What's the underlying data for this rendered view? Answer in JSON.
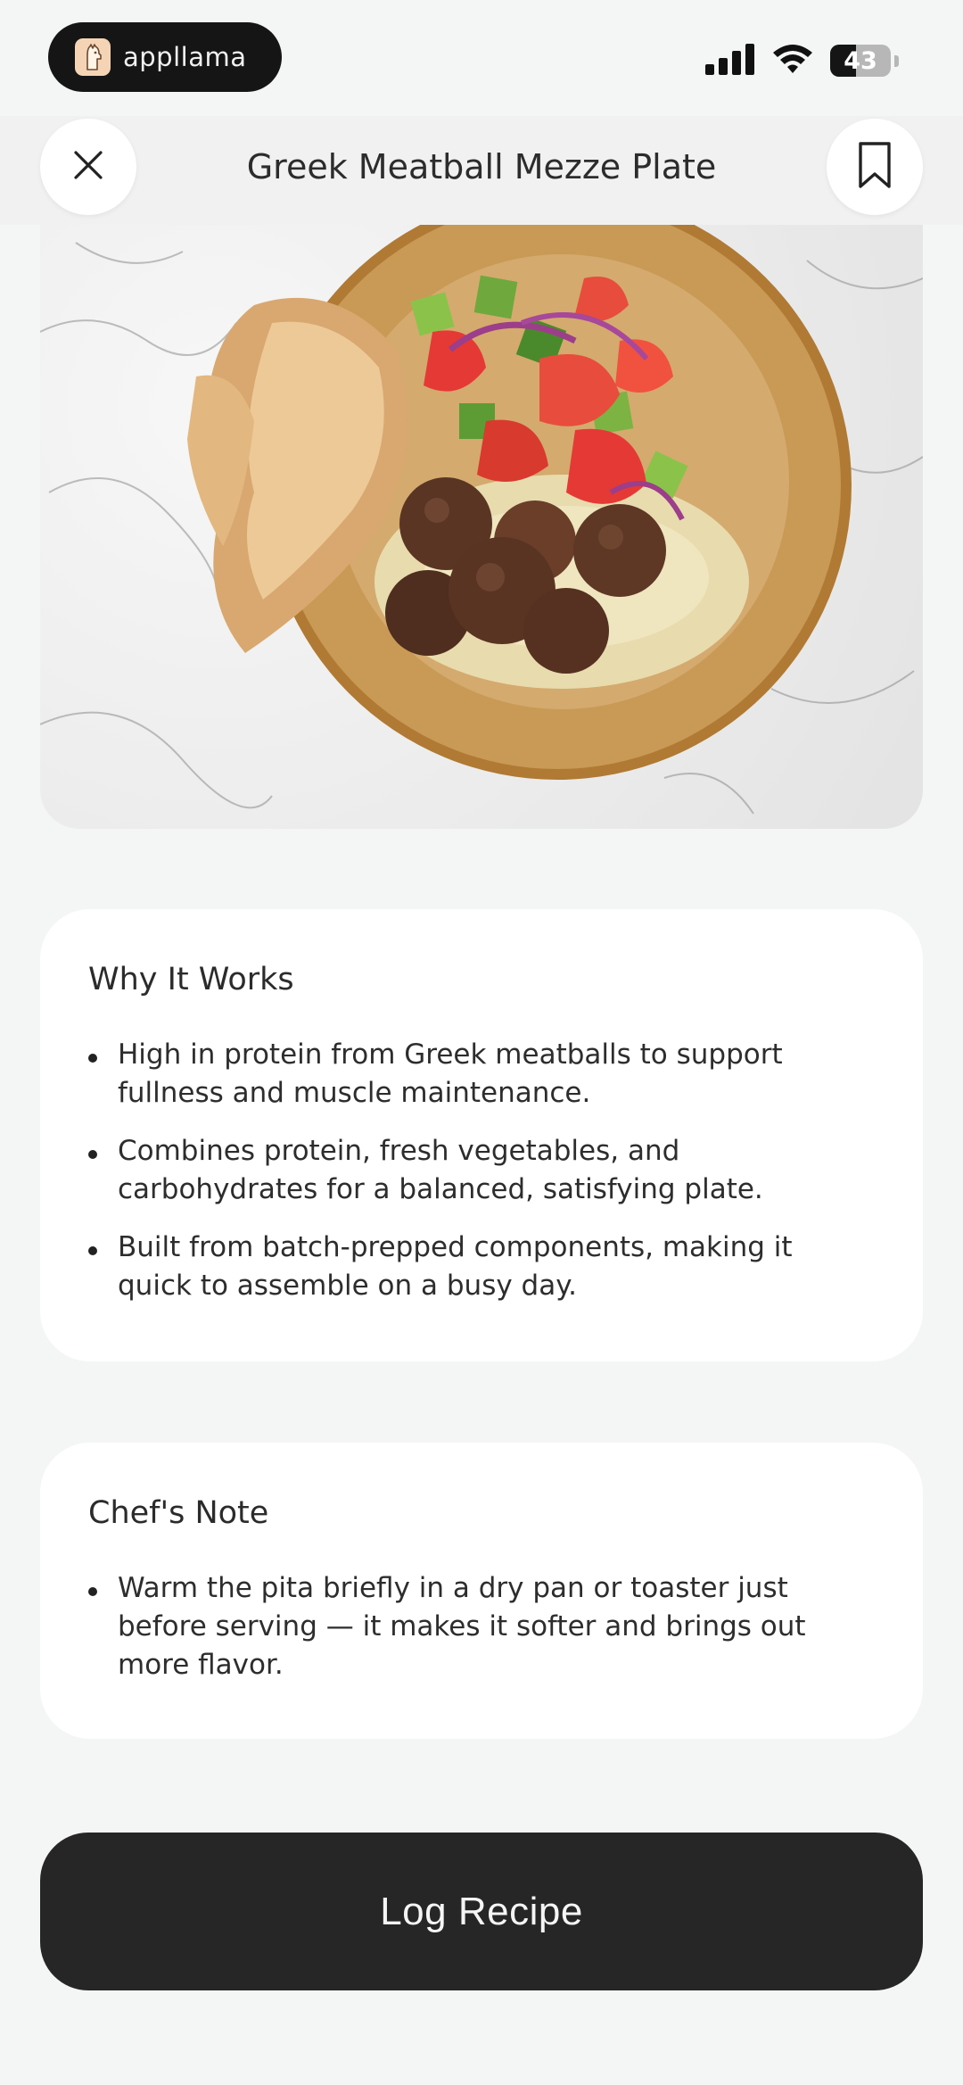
{
  "status_bar": {
    "app_name": "appllama",
    "battery_level": "43",
    "battery_fraction": 0.43
  },
  "header": {
    "title": "Greek Meatball Mezze Plate",
    "close_icon": "close-icon",
    "bookmark_icon": "bookmark-icon"
  },
  "hero": {
    "image_subject": "meal photo"
  },
  "why_it_works": {
    "title": "Why It Works",
    "items": [
      "High in protein from Greek meatballs to support fullness and muscle maintenance.",
      "Combines protein, fresh vegetables, and carbohydrates for a balanced, satisfying plate.",
      "Built from batch-prepped components, making it quick to assemble on a busy day."
    ]
  },
  "chefs_note": {
    "title": "Chef's Note",
    "items": [
      "Warm the pita briefly in a dry pan or toaster just before serving — it makes it softer and brings out more flavor."
    ]
  },
  "cta": {
    "label": "Log Recipe"
  },
  "colors": {
    "background": "#f4f5f5",
    "card": "#ffffff",
    "cta": "#262626",
    "text": "#2a2a2a"
  }
}
